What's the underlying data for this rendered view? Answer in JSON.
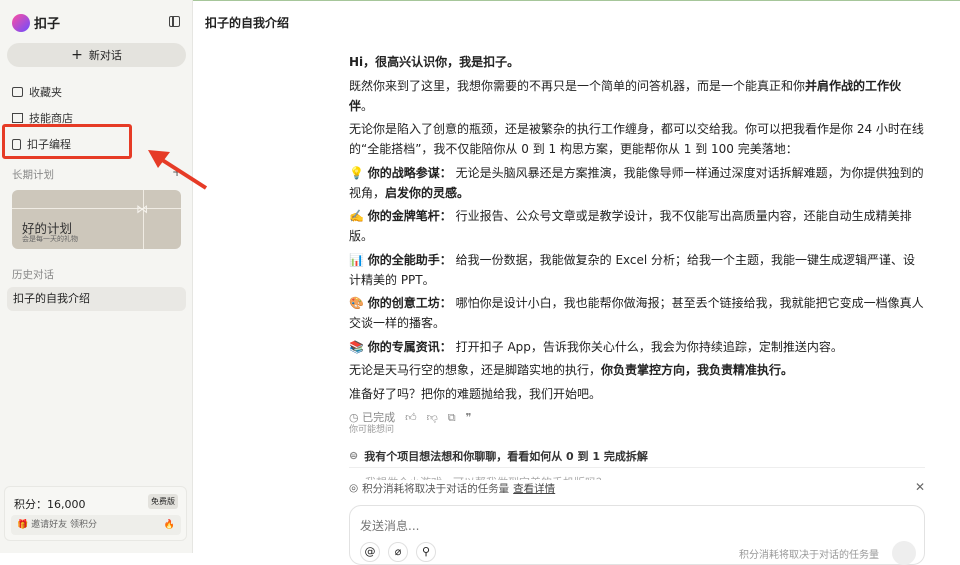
{
  "app": {
    "name": "扣子"
  },
  "sidebar": {
    "new_chat": "新对话",
    "nav": [
      {
        "label": "收藏夹",
        "icon": "folder-icon"
      },
      {
        "label": "技能商店",
        "icon": "books-icon"
      },
      {
        "label": "扣子编程",
        "icon": "code-file-icon"
      }
    ],
    "plans_label": "长期计划",
    "plan_card": {
      "title": "好的计划",
      "subtitle": "会是每一天的礼物"
    },
    "history_label": "历史对话",
    "history": [
      "扣子的自我介绍"
    ],
    "points": {
      "label": "积分：16,000",
      "badge": "免费版",
      "invite": "邀请好友 领积分"
    }
  },
  "header": {
    "title": "扣子的自我介绍"
  },
  "message": {
    "greeting": "Hi，很高兴认识你，我是扣子。",
    "p1a": "既然你来到了这里，我想你需要的不再只是一个简单的问答机器，而是一个能真正和你",
    "p1b": "并肩作战的工作伙伴",
    "p1c": "。",
    "p2": "无论你是陷入了创意的瓶颈，还是被繁杂的执行工作缠身，都可以交给我。你可以把我看作是你 24 小时在线的“全能搭档”，我不仅能陪你从 0 到 1 构思方案，更能帮你从 1 到 100 完美落地：",
    "items": [
      {
        "emoji": "💡",
        "title": "你的战略参谋：",
        "text": "无论是头脑风暴还是方案推演，我能像导师一样通过深度对话拆解难题，为你提供独到的视角，",
        "bold_tail": "启发你的灵感。"
      },
      {
        "emoji": "✍️",
        "title": "你的金牌笔杆：",
        "text": "行业报告、公众号文章或是教学设计，我不仅能写出高质量内容，还能自动生成精美排版。",
        "bold_tail": ""
      },
      {
        "emoji": "📊",
        "title": "你的全能助手：",
        "text": "给我一份数据，我能做复杂的 Excel 分析；给我一个主题，我能一键生成逻辑严谨、设计精美的 PPT。",
        "bold_tail": ""
      },
      {
        "emoji": "🎨",
        "title": "你的创意工坊：",
        "text": "哪怕你是设计小白，我也能帮你做海报；甚至丢个链接给我，我就能把它变成一档像真人交谈一样的播客。",
        "bold_tail": ""
      },
      {
        "emoji": "📚",
        "title": "你的专属资讯：",
        "text": "打开扣子 App，告诉我你关心什么，我会为你持续追踪，定制推送内容。",
        "bold_tail": ""
      }
    ],
    "p3a": "无论是天马行空的想象，还是脚踏实地的执行，",
    "p3b": "你负责掌控方向，我负责精准执行。",
    "p4": "准备好了吗？把你的难题抛给我，我们开始吧。",
    "status": "已完成"
  },
  "suggestions": {
    "label": "你可能想问",
    "items": [
      "我有个项目想法想和你聊聊，看看如何从 0 到 1 完成拆解",
      "我想做个小游戏，可以帮我做到完美的手机版吗？"
    ]
  },
  "notice": {
    "text": "积分消耗将取决于对话的任务量",
    "link": "查看详情"
  },
  "composer": {
    "placeholder": "发送消息...",
    "hint": "积分消耗将取决于对话的任务量"
  }
}
